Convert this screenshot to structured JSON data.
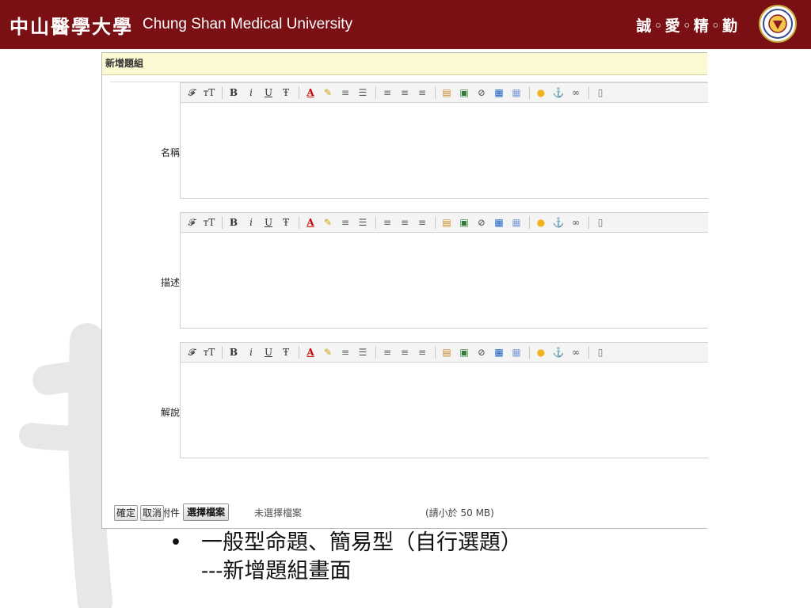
{
  "header": {
    "cn_title": "中山醫學大學",
    "en_title": "Chung Shan Medical University",
    "motto": "誠◦愛◦精◦勤",
    "bg_color": "#7a0f14",
    "seal_icon": "university-seal-icon"
  },
  "dialog": {
    "title": "新增題組",
    "fields": [
      {
        "label": "名稱"
      },
      {
        "label": "描述"
      },
      {
        "label": "解說"
      }
    ],
    "toolbar_icons": [
      "font-family-icon",
      "font-size-icon",
      "separator",
      "bold-icon",
      "italic-icon",
      "underline-icon",
      "strikethrough-icon",
      "separator",
      "text-color-icon",
      "highlight-color-icon",
      "ordered-list-icon",
      "unordered-list-icon",
      "separator",
      "align-left-icon",
      "align-center-icon",
      "align-right-icon",
      "separator",
      "paste-icon",
      "image-icon",
      "flash-icon",
      "table-icon",
      "grid-icon",
      "separator",
      "emoticon-icon",
      "anchor-icon",
      "link-icon",
      "separator",
      "document-icon"
    ],
    "attach": {
      "label": "附件",
      "button": "選擇檔案",
      "status": "未選擇檔案",
      "hint": "(請小於 50 MB)"
    },
    "ok": "確定",
    "cancel": "取消"
  },
  "bullet": {
    "line1": "一般型命題、簡易型（自行選題）",
    "line2": "---新增題組畫面"
  }
}
